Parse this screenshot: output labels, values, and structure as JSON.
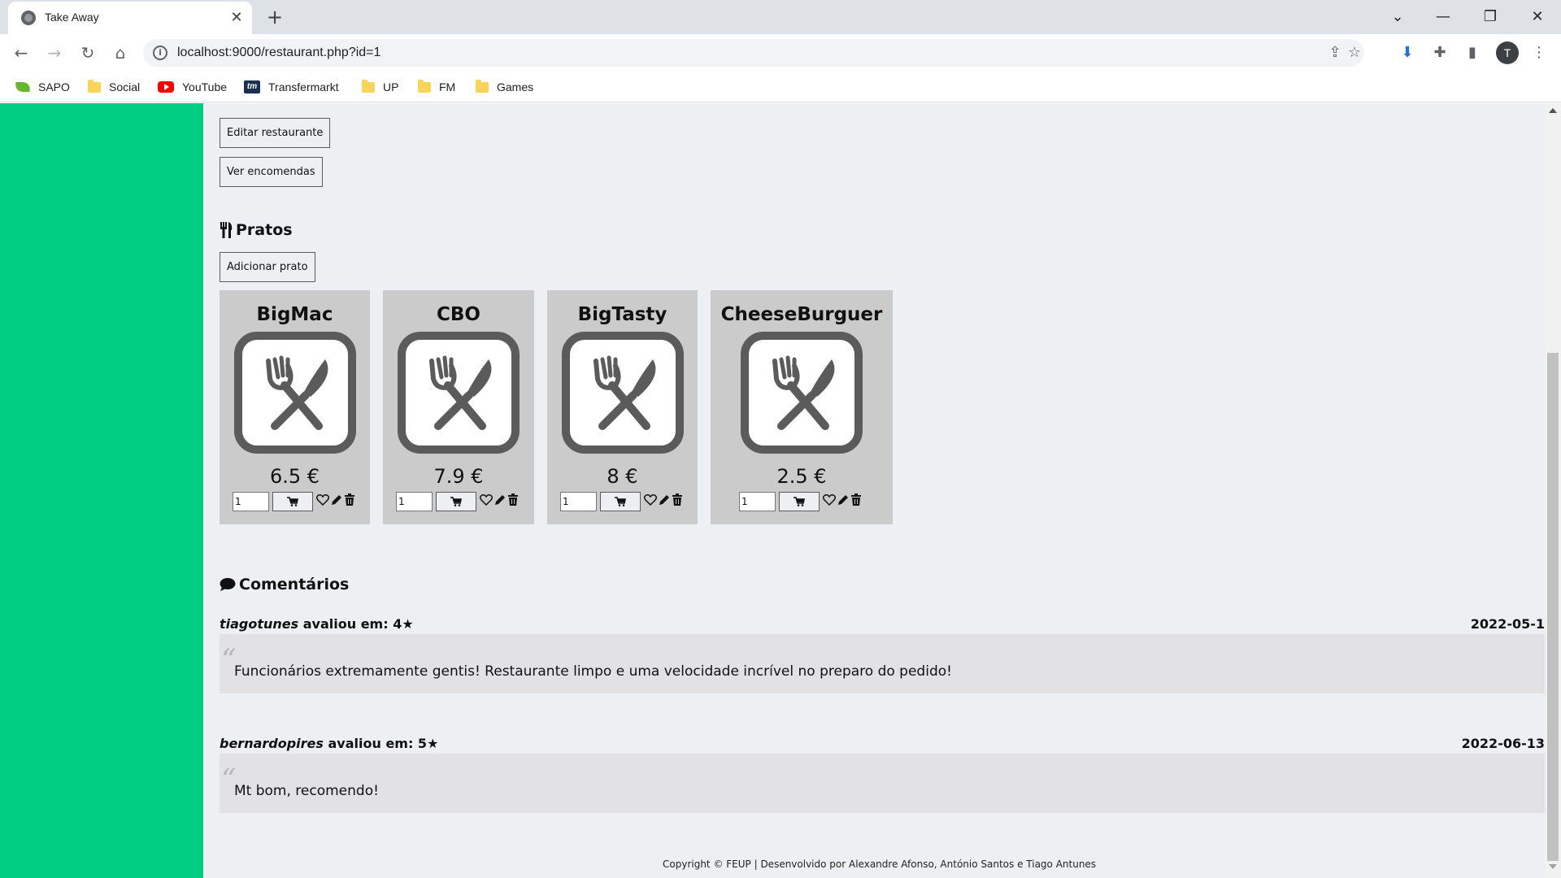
{
  "browser": {
    "tab_title": "Take Away",
    "tab_close": "✕",
    "new_tab": "+",
    "url": "localhost:9000/restaurant.php?id=1",
    "window_controls": {
      "dropdown": "⌄",
      "minimize": "—",
      "restore": "❐",
      "close": "✕"
    },
    "nav": {
      "back": "←",
      "forward": "→",
      "reload": "↻",
      "home": "⌂"
    },
    "avatar_letter": "T",
    "bookmarks": [
      {
        "label": "SAPO",
        "icon": "sapo-icon"
      },
      {
        "label": "Social",
        "icon": "folder-icon"
      },
      {
        "label": "YouTube",
        "icon": "youtube-icon"
      },
      {
        "label": "Transfermarkt",
        "icon": "transfermarkt-icon"
      },
      {
        "label": "UP",
        "icon": "folder-icon"
      },
      {
        "label": "FM",
        "icon": "folder-icon"
      },
      {
        "label": "Games",
        "icon": "folder-icon"
      }
    ]
  },
  "page": {
    "buttons": {
      "edit_restaurant": "Editar restaurante",
      "view_orders": "Ver encomendas",
      "add_dish": "Adicionar prato"
    },
    "dishes_title": "Pratos",
    "dishes": [
      {
        "name": "BigMac",
        "price": "6.5 €",
        "quantity": "1"
      },
      {
        "name": "CBO",
        "price": "7.9 €",
        "quantity": "1"
      },
      {
        "name": "BigTasty",
        "price": "8 €",
        "quantity": "1"
      },
      {
        "name": "CheeseBurguer",
        "price": "2.5 €",
        "quantity": "1"
      }
    ],
    "comments_title": "Comentários",
    "comments": [
      {
        "user": "tiagotunes",
        "rated_label": " avaliou em: 4★",
        "date": "2022-05-1",
        "text": "Funcionários extremamente gentis! Restaurante limpo e uma velocidade incrível no preparo do pedido!"
      },
      {
        "user": "bernardopires",
        "rated_label": " avaliou em: 5★",
        "date": "2022-06-13",
        "text": "Mt bom, recomendo!"
      }
    ],
    "footer": "Copyright © FEUP | Desenvolvido por Alexandre Afonso, António Santos e Tiago Antunes"
  },
  "colors": {
    "sidebar": "#00cc82",
    "page_bg": "#eeeff2",
    "card_bg": "#cbcbcb",
    "comment_bg": "#e2e2e5"
  }
}
